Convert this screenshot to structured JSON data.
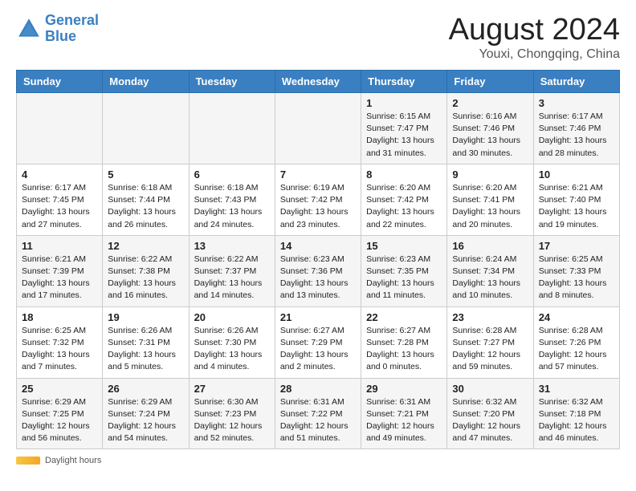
{
  "header": {
    "logo_line1": "General",
    "logo_line2": "Blue",
    "month": "August 2024",
    "location": "Youxi, Chongqing, China"
  },
  "weekdays": [
    "Sunday",
    "Monday",
    "Tuesday",
    "Wednesday",
    "Thursday",
    "Friday",
    "Saturday"
  ],
  "weeks": [
    [
      {
        "day": "",
        "info": ""
      },
      {
        "day": "",
        "info": ""
      },
      {
        "day": "",
        "info": ""
      },
      {
        "day": "",
        "info": ""
      },
      {
        "day": "1",
        "info": "Sunrise: 6:15 AM\nSunset: 7:47 PM\nDaylight: 13 hours and 31 minutes."
      },
      {
        "day": "2",
        "info": "Sunrise: 6:16 AM\nSunset: 7:46 PM\nDaylight: 13 hours and 30 minutes."
      },
      {
        "day": "3",
        "info": "Sunrise: 6:17 AM\nSunset: 7:46 PM\nDaylight: 13 hours and 28 minutes."
      }
    ],
    [
      {
        "day": "4",
        "info": "Sunrise: 6:17 AM\nSunset: 7:45 PM\nDaylight: 13 hours and 27 minutes."
      },
      {
        "day": "5",
        "info": "Sunrise: 6:18 AM\nSunset: 7:44 PM\nDaylight: 13 hours and 26 minutes."
      },
      {
        "day": "6",
        "info": "Sunrise: 6:18 AM\nSunset: 7:43 PM\nDaylight: 13 hours and 24 minutes."
      },
      {
        "day": "7",
        "info": "Sunrise: 6:19 AM\nSunset: 7:42 PM\nDaylight: 13 hours and 23 minutes."
      },
      {
        "day": "8",
        "info": "Sunrise: 6:20 AM\nSunset: 7:42 PM\nDaylight: 13 hours and 22 minutes."
      },
      {
        "day": "9",
        "info": "Sunrise: 6:20 AM\nSunset: 7:41 PM\nDaylight: 13 hours and 20 minutes."
      },
      {
        "day": "10",
        "info": "Sunrise: 6:21 AM\nSunset: 7:40 PM\nDaylight: 13 hours and 19 minutes."
      }
    ],
    [
      {
        "day": "11",
        "info": "Sunrise: 6:21 AM\nSunset: 7:39 PM\nDaylight: 13 hours and 17 minutes."
      },
      {
        "day": "12",
        "info": "Sunrise: 6:22 AM\nSunset: 7:38 PM\nDaylight: 13 hours and 16 minutes."
      },
      {
        "day": "13",
        "info": "Sunrise: 6:22 AM\nSunset: 7:37 PM\nDaylight: 13 hours and 14 minutes."
      },
      {
        "day": "14",
        "info": "Sunrise: 6:23 AM\nSunset: 7:36 PM\nDaylight: 13 hours and 13 minutes."
      },
      {
        "day": "15",
        "info": "Sunrise: 6:23 AM\nSunset: 7:35 PM\nDaylight: 13 hours and 11 minutes."
      },
      {
        "day": "16",
        "info": "Sunrise: 6:24 AM\nSunset: 7:34 PM\nDaylight: 13 hours and 10 minutes."
      },
      {
        "day": "17",
        "info": "Sunrise: 6:25 AM\nSunset: 7:33 PM\nDaylight: 13 hours and 8 minutes."
      }
    ],
    [
      {
        "day": "18",
        "info": "Sunrise: 6:25 AM\nSunset: 7:32 PM\nDaylight: 13 hours and 7 minutes."
      },
      {
        "day": "19",
        "info": "Sunrise: 6:26 AM\nSunset: 7:31 PM\nDaylight: 13 hours and 5 minutes."
      },
      {
        "day": "20",
        "info": "Sunrise: 6:26 AM\nSunset: 7:30 PM\nDaylight: 13 hours and 4 minutes."
      },
      {
        "day": "21",
        "info": "Sunrise: 6:27 AM\nSunset: 7:29 PM\nDaylight: 13 hours and 2 minutes."
      },
      {
        "day": "22",
        "info": "Sunrise: 6:27 AM\nSunset: 7:28 PM\nDaylight: 13 hours and 0 minutes."
      },
      {
        "day": "23",
        "info": "Sunrise: 6:28 AM\nSunset: 7:27 PM\nDaylight: 12 hours and 59 minutes."
      },
      {
        "day": "24",
        "info": "Sunrise: 6:28 AM\nSunset: 7:26 PM\nDaylight: 12 hours and 57 minutes."
      }
    ],
    [
      {
        "day": "25",
        "info": "Sunrise: 6:29 AM\nSunset: 7:25 PM\nDaylight: 12 hours and 56 minutes."
      },
      {
        "day": "26",
        "info": "Sunrise: 6:29 AM\nSunset: 7:24 PM\nDaylight: 12 hours and 54 minutes."
      },
      {
        "day": "27",
        "info": "Sunrise: 6:30 AM\nSunset: 7:23 PM\nDaylight: 12 hours and 52 minutes."
      },
      {
        "day": "28",
        "info": "Sunrise: 6:31 AM\nSunset: 7:22 PM\nDaylight: 12 hours and 51 minutes."
      },
      {
        "day": "29",
        "info": "Sunrise: 6:31 AM\nSunset: 7:21 PM\nDaylight: 12 hours and 49 minutes."
      },
      {
        "day": "30",
        "info": "Sunrise: 6:32 AM\nSunset: 7:20 PM\nDaylight: 12 hours and 47 minutes."
      },
      {
        "day": "31",
        "info": "Sunrise: 6:32 AM\nSunset: 7:18 PM\nDaylight: 12 hours and 46 minutes."
      }
    ]
  ],
  "footer": {
    "daylight_label": "Daylight hours"
  }
}
